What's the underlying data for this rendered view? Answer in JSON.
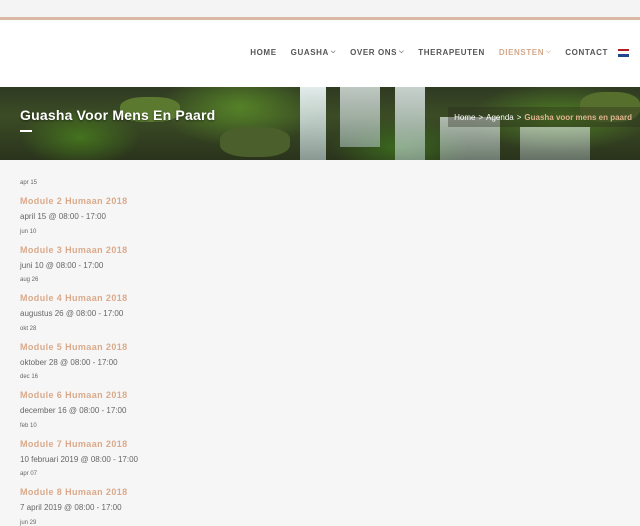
{
  "nav": {
    "items": [
      {
        "label": "HOME",
        "dropdown": false,
        "active": false
      },
      {
        "label": "GUASHA",
        "dropdown": true,
        "active": false
      },
      {
        "label": "OVER ONS",
        "dropdown": true,
        "active": false
      },
      {
        "label": "THERAPEUTEN",
        "dropdown": false,
        "active": false
      },
      {
        "label": "DIENSTEN",
        "dropdown": true,
        "active": true
      },
      {
        "label": "CONTACT",
        "dropdown": false,
        "active": false
      }
    ],
    "flag_colors": [
      "#ae1c28",
      "#ffffff",
      "#21468b"
    ]
  },
  "hero": {
    "title": "Guasha Voor Mens En Paard",
    "breadcrumb": {
      "home": "Home",
      "sep": ">",
      "agenda": "Agenda",
      "current": "Guasha voor mens en paard"
    }
  },
  "events": [
    {
      "date": "apr 15",
      "title": "Module 2 Humaan 2018",
      "time": "april 15 @ 08:00 - 17:00"
    },
    {
      "date": "jun 10",
      "title": "Module 3 Humaan 2018",
      "time": "juni 10 @ 08:00 - 17:00"
    },
    {
      "date": "aug 26",
      "title": "Module 4 Humaan 2018",
      "time": "augustus 26 @ 08:00 - 17:00"
    },
    {
      "date": "okt 28",
      "title": "Module 5 Humaan 2018",
      "time": "oktober 28 @ 08:00 - 17:00"
    },
    {
      "date": "dec 16",
      "title": "Module 6 Humaan 2018",
      "time": "december 16 @ 08:00 - 17:00"
    },
    {
      "date": "feb 10",
      "title": "Module 7 Humaan 2018",
      "time": "10 februari 2019 @ 08:00 - 17:00"
    },
    {
      "date": "apr 07",
      "title": "Module 8 Humaan 2018",
      "time": "7 april 2019 @ 08:00 - 17:00"
    },
    {
      "date": "jun 29",
      "title": "",
      "time": ""
    }
  ],
  "colors": {
    "accent": "#d3a98c",
    "top_border": "#d9b8a4"
  }
}
